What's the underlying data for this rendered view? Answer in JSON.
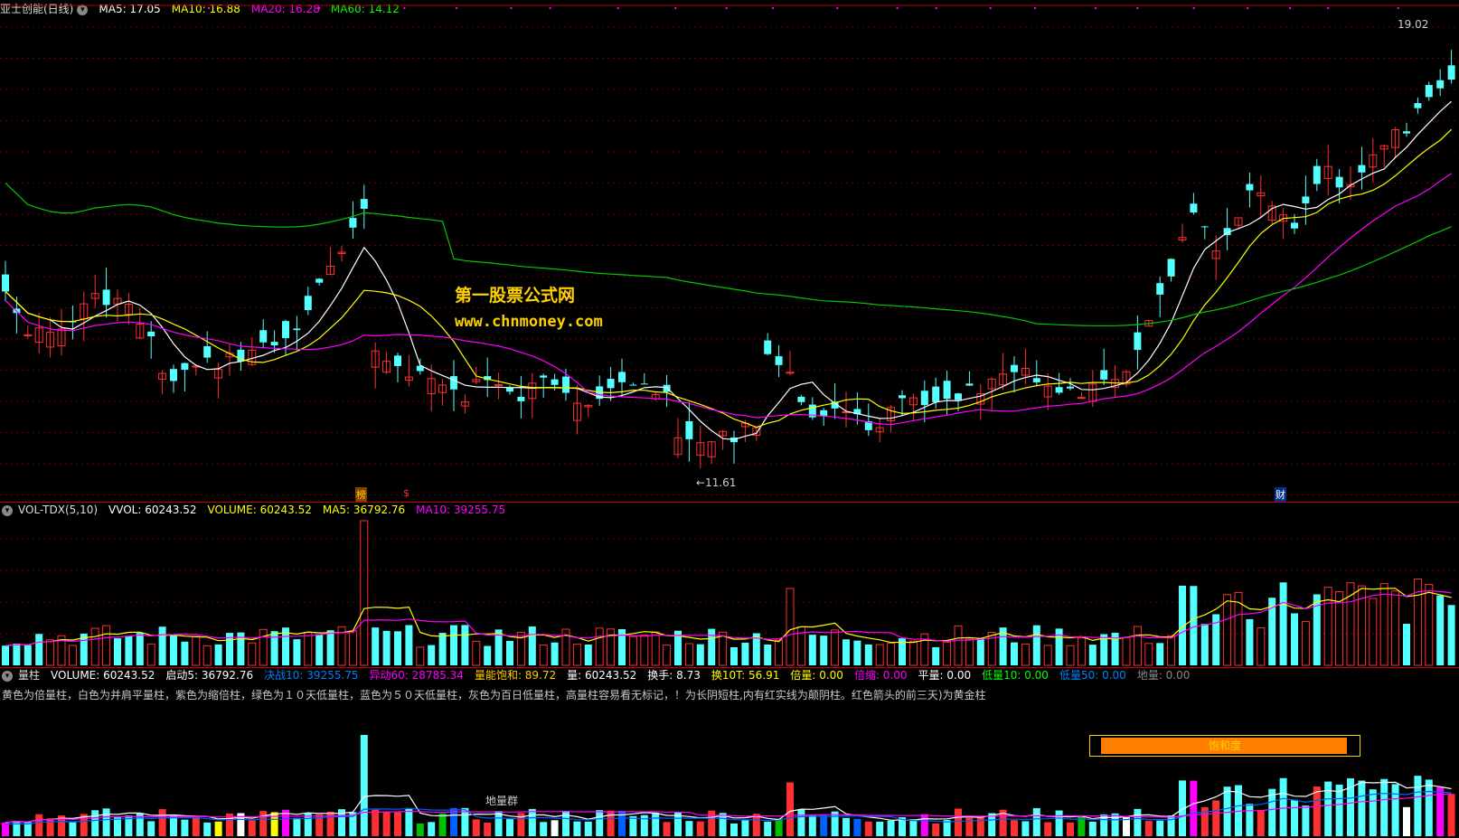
{
  "main": {
    "title": "亚士创能(日线)",
    "indicators": [
      {
        "label": "MA5: 17.05",
        "color": "#ffffff"
      },
      {
        "label": "MA10: 16.88",
        "color": "#ffff00"
      },
      {
        "label": "MA20: 16.28",
        "color": "#ff00ff"
      },
      {
        "label": "MA60: 14.12",
        "color": "#00ff00"
      }
    ],
    "high_label": "19.02",
    "low_label": "←11.61",
    "markers": [
      "榜",
      "$",
      "财"
    ]
  },
  "watermark": {
    "line1": "第一股票公式网",
    "line2": "www.chnmoney.com"
  },
  "vol_panel": {
    "name": "VOL-TDX(5,10)",
    "indicators": [
      {
        "label": "VVOL: 60243.52",
        "color": "#ffffff"
      },
      {
        "label": "VOLUME: 60243.52",
        "color": "#ffff00"
      },
      {
        "label": "MA5: 36792.76",
        "color": "#ffff00"
      },
      {
        "label": "MA10: 39255.75",
        "color": "#ff00ff"
      }
    ]
  },
  "liang_panel": {
    "name": "量柱",
    "indicators": [
      {
        "label": "VOLUME: 60243.52",
        "color": "#ffffff"
      },
      {
        "label": "启动5: 36792.76",
        "color": "#ffffff"
      },
      {
        "label": "决战10: 39255.75",
        "color": "#0080ff"
      },
      {
        "label": "异动60: 28785.34",
        "color": "#ff00ff"
      },
      {
        "label": "量能饱和: 89.72",
        "color": "#ffcc00"
      },
      {
        "label": "量: 60243.52",
        "color": "#ffffff"
      },
      {
        "label": "换手: 8.73",
        "color": "#ffffff"
      },
      {
        "label": "换10T: 56.91",
        "color": "#ffff00"
      },
      {
        "label": "倍量: 0.00",
        "color": "#ffff00"
      },
      {
        "label": "倍缩: 0.00",
        "color": "#ff00ff"
      },
      {
        "label": "平量: 0.00",
        "color": "#ffffff"
      },
      {
        "label": "低量10: 0.00",
        "color": "#00ff00"
      },
      {
        "label": "低量50: 0.00",
        "color": "#0080ff"
      },
      {
        "label": "地量: 0.00",
        "color": "#888888"
      }
    ],
    "note": "黄色为倍量柱，白色为并肩平量柱，紫色为缩倍柱，绿色为１０天低量柱，蓝色为５０天低量柱，灰色为百日低量柱，高量柱容易看无标记，！为长阴短柱,内有红实线为颠阴柱。红色箭头的前三天)为黄金柱",
    "saturation_label": "饱和度",
    "ground_group_label": "地量群"
  }
}
